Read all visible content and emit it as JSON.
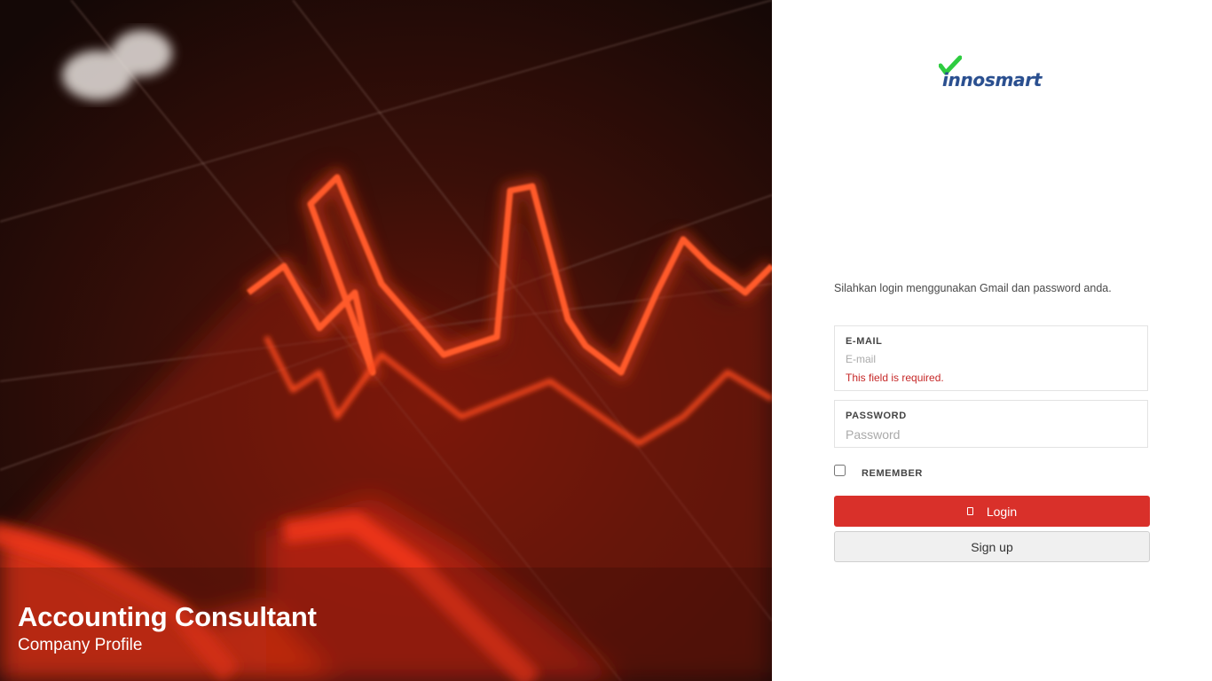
{
  "hero": {
    "title": "Accounting Consultant",
    "subtitle": "Company Profile"
  },
  "brand": {
    "name": "innosmart",
    "check_color": "#2ecc40",
    "text_color": "#2a4f8f"
  },
  "login": {
    "intro": "Silahkan login menggunakan Gmail dan password anda.",
    "email": {
      "label": "E-MAIL",
      "placeholder": "E-mail",
      "value": "",
      "error": "This field is required."
    },
    "password": {
      "label": "PASSWORD",
      "placeholder": "Password",
      "value": ""
    },
    "remember": {
      "label": "REMEMBER",
      "checked": false
    },
    "login_button": {
      "label": "Login",
      "icon": "login-icon"
    },
    "signup_button": {
      "label": "Sign up"
    }
  },
  "colors": {
    "primary": "#d9302a",
    "error": "#c62828",
    "hero_glow": "#ff3a1a"
  }
}
